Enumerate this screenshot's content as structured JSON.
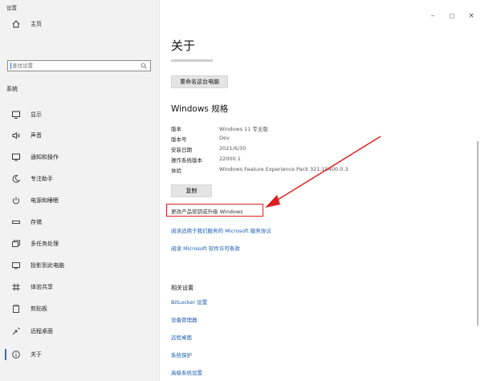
{
  "window": {
    "title": "设置",
    "minimize": "–",
    "maximize": "□",
    "close": "×"
  },
  "sidebar": {
    "home": "主页",
    "search": {
      "placeholder": "查找设置"
    },
    "section_title": "系统",
    "items": [
      {
        "label": "显示",
        "icon": "monitor-icon"
      },
      {
        "label": "声音",
        "icon": "speaker-icon"
      },
      {
        "label": "通知和操作",
        "icon": "notification-icon"
      },
      {
        "label": "专注助手",
        "icon": "moon-icon"
      },
      {
        "label": "电源和睡眠",
        "icon": "power-icon"
      },
      {
        "label": "存储",
        "icon": "storage-icon"
      },
      {
        "label": "多任务处理",
        "icon": "multitask-icon"
      },
      {
        "label": "投影到此电脑",
        "icon": "projection-icon"
      },
      {
        "label": "体验共享",
        "icon": "share-icon"
      },
      {
        "label": "剪贴板",
        "icon": "clipboard-icon"
      },
      {
        "label": "远程桌面",
        "icon": "remote-desktop-icon"
      },
      {
        "label": "关于",
        "icon": "info-icon",
        "active": true
      }
    ]
  },
  "main": {
    "title": "关于",
    "rename_button": "重命名这台电脑",
    "specs_title": "Windows 规格",
    "specs": [
      {
        "label": "版本",
        "value": "Windows 11 专业版"
      },
      {
        "label": "版本号",
        "value": "Dev"
      },
      {
        "label": "安装日期",
        "value": "2021/6/30"
      },
      {
        "label": "操作系统版本",
        "value": "22000.1"
      },
      {
        "label": "体验",
        "value": "Windows Feature Experience Pack 321.15400.0.3"
      }
    ],
    "copy_button": "复制",
    "links": [
      "更改产品密钥或升级 Windows",
      "阅读适用于我们服务的 Microsoft 服务协议",
      "阅读 Microsoft 软件许可条款"
    ],
    "related_title": "相关设置",
    "related_links": [
      "BitLocker 设置",
      "设备管理器",
      "远程桌面",
      "系统保护",
      "高级系统设置"
    ]
  },
  "colors": {
    "accent": "#2a6ccf",
    "link": "#1a5cb5",
    "highlight": "#e02020",
    "sidebar_bg": "#f2f2f2"
  }
}
